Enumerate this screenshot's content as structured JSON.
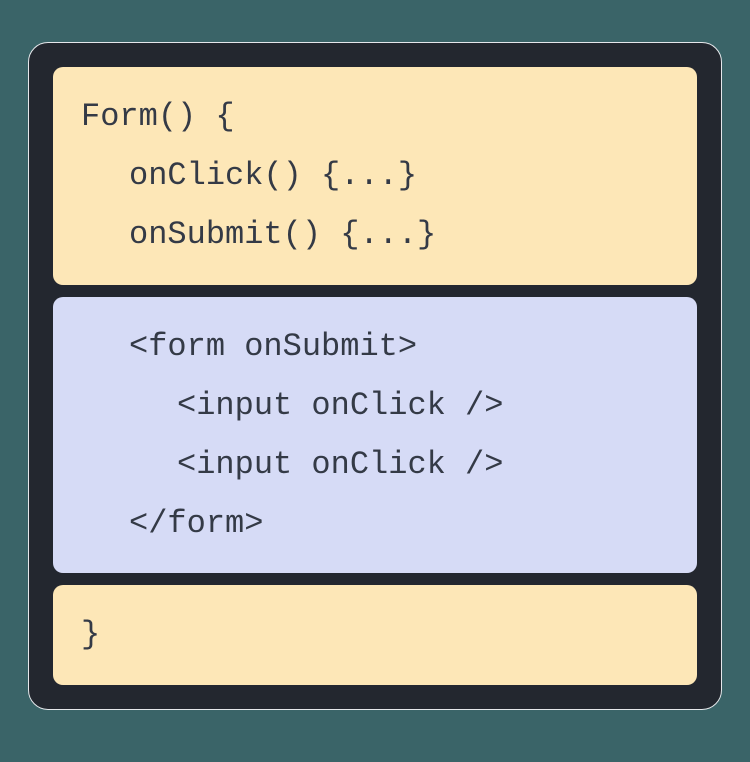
{
  "blocks": {
    "top": {
      "line1": "Form() {",
      "line2": "onClick() {...}",
      "line3": "onSubmit() {...}"
    },
    "middle": {
      "line1": "<form onSubmit>",
      "line2": "<input onClick />",
      "line3": "<input onClick />",
      "line4": "</form>"
    },
    "bottom": {
      "line1": "}"
    }
  }
}
